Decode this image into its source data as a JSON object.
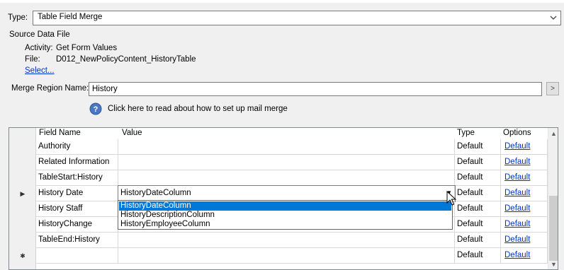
{
  "type_row": {
    "label": "Type:",
    "selected": "Table Field Merge"
  },
  "source": {
    "heading": "Source Data File",
    "activity_label": "Activity:",
    "activity_value": "Get Form Values",
    "file_label": "File:",
    "file_value": "D012_NewPolicyContent_HistoryTable",
    "select_link": "Select..."
  },
  "merge_region": {
    "label": "Merge Region Name:",
    "value": "History",
    "button_label": ">"
  },
  "help": {
    "text": "Click here to read about how to set up mail merge"
  },
  "grid": {
    "headers": {
      "field_name": "Field Name",
      "value": "Value",
      "type": "Type",
      "options": "Options"
    },
    "rows": [
      {
        "marker": "",
        "field": "Authority",
        "value": "",
        "type": "Default",
        "option": "Default"
      },
      {
        "marker": "",
        "field": "Related Information",
        "value": "",
        "type": "Default",
        "option": "Default"
      },
      {
        "marker": "",
        "field": "TableStart:History",
        "value": "",
        "type": "Default",
        "option": "Default"
      },
      {
        "marker": "current",
        "field": "History Date",
        "value": "HistoryDateColumn",
        "type": "Default",
        "option": "Default"
      },
      {
        "marker": "",
        "field": "History Staff",
        "value": "",
        "type": "Default",
        "option": "Default"
      },
      {
        "marker": "",
        "field": "HistoryChange",
        "value": "",
        "type": "Default",
        "option": "Default"
      },
      {
        "marker": "",
        "field": "TableEnd:History",
        "value": "",
        "type": "Default",
        "option": "Default"
      },
      {
        "marker": "new",
        "field": "",
        "value": "",
        "type": "Default",
        "option": "Default"
      }
    ],
    "markers": {
      "current": "▶",
      "new": "✱"
    }
  },
  "dropdown": {
    "options": [
      "HistoryDateColumn",
      "HistoryDescriptionColumn",
      "HistoryEmployeeColumn"
    ],
    "selected_index": 0
  },
  "colors": {
    "selection": "#0078d7",
    "link": "#0033cc"
  }
}
